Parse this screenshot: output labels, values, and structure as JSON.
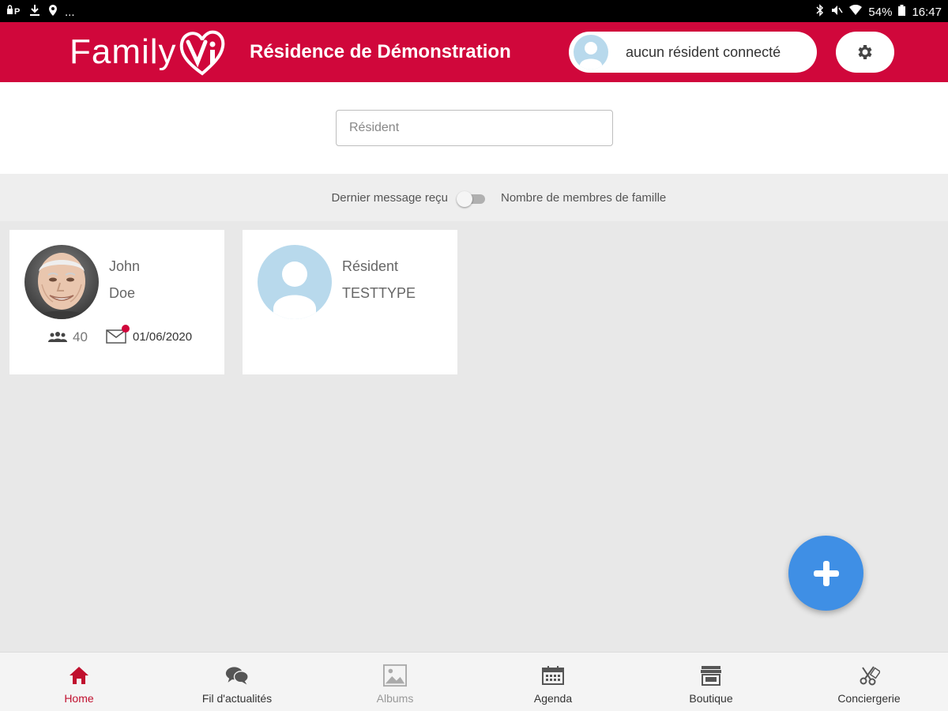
{
  "status_bar": {
    "left_icons": [
      "lock-p-icon",
      "download-icon",
      "location-icon"
    ],
    "overflow": "...",
    "battery": "54%",
    "time": "16:47"
  },
  "header": {
    "logo_text": "Family",
    "logo_mark_text": "Vi",
    "residence_name": "Résidence de Démonstration",
    "resident_status": "aucun résident connecté",
    "settings_icon": "gear-icon",
    "brand_color": "#d0073b"
  },
  "search": {
    "placeholder": "Résident"
  },
  "sort": {
    "left_label": "Dernier message reçu",
    "right_label": "Nombre de membres de famille"
  },
  "residents": [
    {
      "first_name": "John",
      "last_name": "Doe",
      "family_count": "40",
      "last_message_date": "01/06/2020",
      "has_photo": true
    },
    {
      "first_name": "Résident",
      "last_name": "TESTTYPE",
      "has_photo": false
    }
  ],
  "fab": {
    "icon": "plus-icon",
    "color": "#3f8fe5"
  },
  "bottom_nav": [
    {
      "label": "Home",
      "icon": "home-icon",
      "state": "active"
    },
    {
      "label": "Fil d'actualités",
      "icon": "chat-bubbles-icon",
      "state": "normal"
    },
    {
      "label": "Albums",
      "icon": "image-icon",
      "state": "disabled"
    },
    {
      "label": "Agenda",
      "icon": "calendar-icon",
      "state": "normal"
    },
    {
      "label": "Boutique",
      "icon": "store-icon",
      "state": "normal"
    },
    {
      "label": "Conciergerie",
      "icon": "scissors-comb-icon",
      "state": "normal"
    }
  ]
}
